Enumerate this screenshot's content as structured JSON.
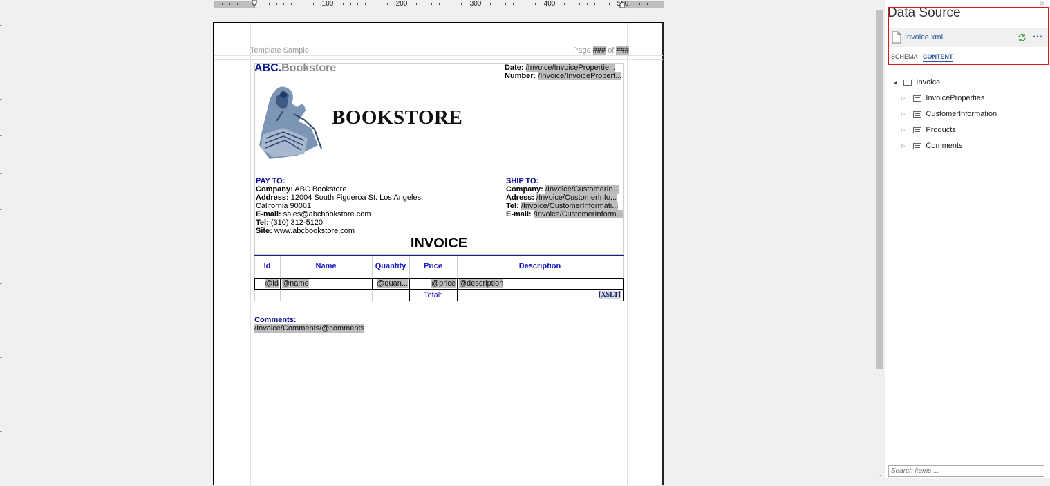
{
  "ruler": {
    "labels": [
      "100",
      "200",
      "300",
      "400",
      "500"
    ]
  },
  "page_header": {
    "title": "Template Sample",
    "page_prefix": "Page",
    "page_num": "###",
    "of": "of",
    "page_total": "###"
  },
  "invoice": {
    "logo_abc": "ABC.",
    "logo_bookstore": "Bookstore",
    "logo_caption": "BOOKSTORE",
    "date_label": "Date:",
    "date_value": "/Invoice/InvoicePropertie...",
    "number_label": "Number:",
    "number_value": "/Invoice/InvoicePropert...",
    "pay_to": {
      "title": "PAY TO:",
      "company_label": "Company:",
      "company": "ABC Bookstore",
      "address_label": "Address:",
      "address_line1": "12004 South Figueroa St. Los Angeles,",
      "address_line2": "California 90061",
      "email_label": "E-mail:",
      "email": "sales@abcbookstore.com",
      "tel_label": "Tel:",
      "tel": "(310) 312-5120",
      "site_label": "Site:",
      "site": "www.abcbookstore.com"
    },
    "ship_to": {
      "title": "SHIP TO:",
      "company_label": "Company:",
      "company": "/Invoice/CustomerIn...",
      "address_label": "Adress:",
      "address": "/Invoice/CustomerInfo...",
      "tel_label": "Tel:",
      "tel": "/Invoice/CustomerInformati...",
      "email_label": "E-mail:",
      "email": "/Invoice/CustomerInform..."
    },
    "heading": "INVOICE",
    "columns": [
      "Id",
      "Name",
      "Quantity",
      "Price",
      "Description"
    ],
    "row": [
      "@id",
      "@name",
      "@quan...",
      "@price",
      "@description"
    ],
    "total_label": "Total:",
    "total_value": "[XSLT]",
    "comments_label": "Comments:",
    "comments_value": "/Invoice/Comments/@comments"
  },
  "panel": {
    "title": "Data Source",
    "file": "Invoice.xml",
    "tabs": [
      "SCHEMA",
      "CONTENT"
    ],
    "active_tab": "CONTENT",
    "tree_root": "Invoice",
    "tree_children": [
      "InvoiceProperties",
      "CustomerInformation",
      "Products",
      "Comments"
    ],
    "search_placeholder": "Search items ...",
    "accent": "#2b579a",
    "highlight": "#e0141e"
  }
}
